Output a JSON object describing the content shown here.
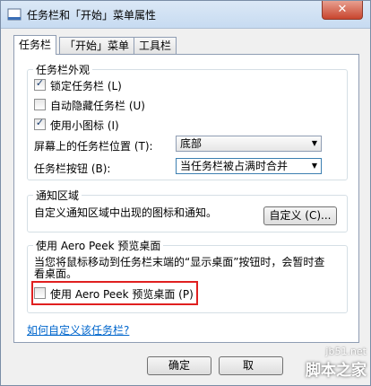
{
  "window": {
    "title": "任务栏和「开始」菜单属性",
    "close_label": "✕"
  },
  "tabs": [
    {
      "label": "任务栏"
    },
    {
      "label": "「开始」菜单"
    },
    {
      "label": "工具栏"
    }
  ],
  "appearance": {
    "title": "任务栏外观",
    "lock": {
      "label": "锁定任务栏 (L)",
      "checked": true
    },
    "autohide": {
      "label": "自动隐藏任务栏 (U)",
      "checked": false
    },
    "small_icons": {
      "label": "使用小图标 (I)",
      "checked": true
    },
    "location_label": "屏幕上的任务栏位置 (T):",
    "location_value": "底部",
    "buttons_label": "任务栏按钮 (B):",
    "buttons_value": "当任务栏被占满时合并"
  },
  "notification": {
    "title": "通知区域",
    "desc": "自定义通知区域中出现的图标和通知。",
    "customize_label": "自定义 (C)..."
  },
  "peek": {
    "title": "使用 Aero Peek 预览桌面",
    "desc": "当您将鼠标移动到任务栏末端的“显示桌面”按钮时，会暂时查看桌面。",
    "checkbox_label": "使用 Aero Peek 预览桌面 (P)",
    "checked": false
  },
  "help_link": "如何自定义该任务栏?",
  "footer": {
    "ok_label": "确定",
    "cancel_label": "取"
  },
  "watermark": {
    "url": "jb51.net",
    "name": "脚本之家"
  }
}
